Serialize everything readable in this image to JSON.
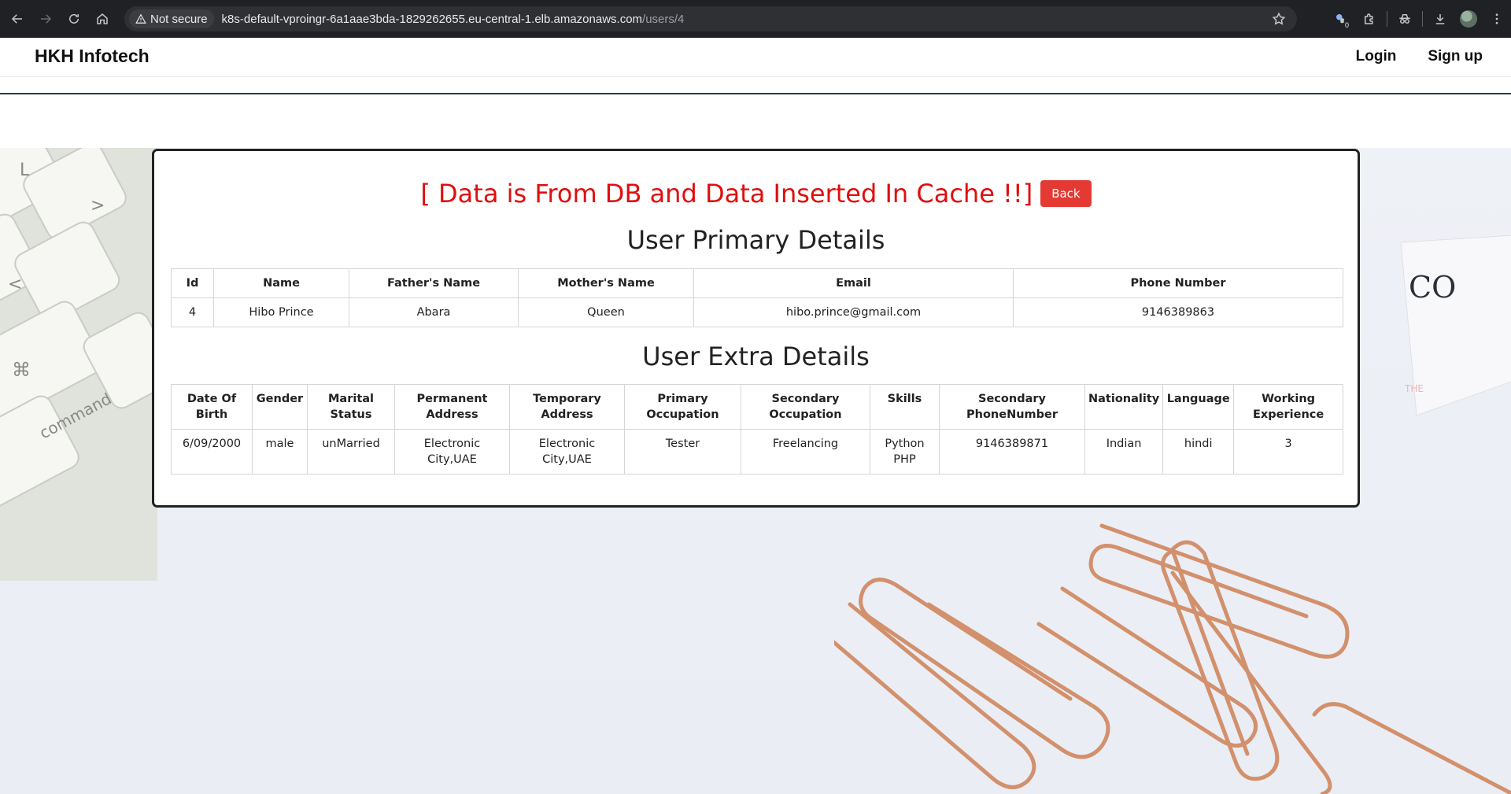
{
  "browser": {
    "security_label": "Not secure",
    "url_host": "k8s-default-vproingr-6a1aae3bda-1829262655.eu-central-1.elb.amazonaws.com",
    "url_path": "/users/4",
    "extension_badge": "0"
  },
  "navbar": {
    "brand": "HKH Infotech",
    "login_label": "Login",
    "signup_label": "Sign up"
  },
  "panel": {
    "status_message": "[ Data is From DB and Data Inserted In Cache !!]",
    "back_label": "Back",
    "primary_title": "User Primary Details",
    "extra_title": "User Extra Details"
  },
  "primary_table": {
    "headers": [
      "Id",
      "Name",
      "Father's Name",
      "Mother's Name",
      "Email",
      "Phone Number"
    ],
    "row": [
      "4",
      "Hibo Prince",
      "Abara",
      "Queen",
      "hibo.prince@gmail.com",
      "9146389863"
    ]
  },
  "extra_table": {
    "headers": [
      "Date Of Birth",
      "Gender",
      "Marital Status",
      "Permanent Address",
      "Temporary Address",
      "Primary Occupation",
      "Secondary Occupation",
      "Skills",
      "Secondary PhoneNumber",
      "Nationality",
      "Language",
      "Working Experience"
    ],
    "row": [
      "6/09/2000",
      "male",
      "unMarried",
      "Electronic City,UAE",
      "Electronic City,UAE",
      "Tester",
      "Freelancing",
      "Python PHP",
      "9146389871",
      "Indian",
      "hindi",
      "3"
    ]
  },
  "colors": {
    "status_red": "#e10e0e",
    "back_button": "#e43a33",
    "chrome_bg": "#202124"
  },
  "icons": [
    "back-arrow-icon",
    "forward-arrow-icon",
    "reload-icon",
    "home-icon",
    "warning-icon",
    "star-icon",
    "extension-icon",
    "puzzle-icon",
    "incognito-icon",
    "download-icon",
    "avatar",
    "menu-icon"
  ]
}
